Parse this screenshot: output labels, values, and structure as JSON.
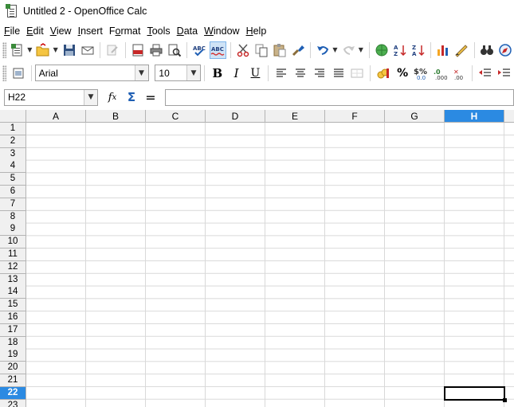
{
  "window": {
    "title": "Untitled 2 - OpenOffice Calc",
    "icon": "calc-document-icon"
  },
  "menu": [
    {
      "label": "File",
      "u": "F",
      "rest": "ile"
    },
    {
      "label": "Edit",
      "u": "E",
      "rest": "dit"
    },
    {
      "label": "View",
      "u": "V",
      "rest": "iew"
    },
    {
      "label": "Insert",
      "u": "I",
      "rest": "nsert"
    },
    {
      "label": "Format",
      "pre": "F",
      "u": "o",
      "rest": "rmat"
    },
    {
      "label": "Tools",
      "u": "T",
      "rest": "ools"
    },
    {
      "label": "Data",
      "u": "D",
      "rest": "ata"
    },
    {
      "label": "Window",
      "u": "W",
      "rest": "indow"
    },
    {
      "label": "Help",
      "u": "H",
      "rest": "elp"
    }
  ],
  "toolbar_standard": {
    "icons": [
      "new-icon",
      "open-icon",
      "save-icon",
      "email-icon",
      "edit-file-icon",
      "export-pdf-icon",
      "print-icon",
      "page-preview-icon",
      "spellcheck-icon",
      "autospellcheck-icon",
      "cut-icon",
      "copy-icon",
      "paste-icon",
      "clone-formatting-icon",
      "undo-icon",
      "redo-icon",
      "hyperlink-icon",
      "sort-ascending-icon",
      "sort-descending-icon",
      "chart-icon",
      "show-draw-functions-icon",
      "find-replace-icon",
      "navigator-icon"
    ]
  },
  "toolbar_formatting": {
    "font_name": "Arial",
    "font_size": "10",
    "bold": "B",
    "italic": "I",
    "underline": "U"
  },
  "formula_bar": {
    "name_box": "H22",
    "formula": ""
  },
  "sheet": {
    "columns": [
      "A",
      "B",
      "C",
      "D",
      "E",
      "F",
      "G",
      "H"
    ],
    "selected_column": "H",
    "rows": [
      "1",
      "2",
      "3",
      "4",
      "5",
      "6",
      "7",
      "8",
      "9",
      "10",
      "11",
      "12",
      "13",
      "14",
      "15",
      "16",
      "17",
      "18",
      "19",
      "20",
      "21",
      "22",
      "23"
    ],
    "selected_row": "22",
    "active_cell": "H22"
  },
  "colors": {
    "selection_header": "#2b8ae2",
    "grid_line": "#d9d9d9",
    "header_bg": "#f0f0f0"
  }
}
